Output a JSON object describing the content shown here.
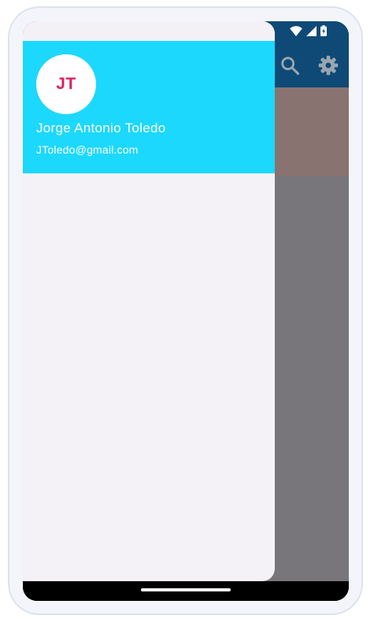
{
  "drawer": {
    "avatar_initials": "JT",
    "account_name": "Jorge Antonio Toledo",
    "account_email": "JToledo@gmail.com"
  },
  "app_bar": {
    "actions": [
      "search-icon",
      "gear-icon"
    ]
  },
  "status_bar": {
    "icons": [
      "wifi-icon",
      "cellular-signal-icon",
      "battery-icon"
    ]
  },
  "colors": {
    "drawer_header": "#1cd8fc",
    "avatar_text": "#d9215f",
    "drawer_background": "#f4f2f7",
    "app_bar": "#0f4a77"
  }
}
